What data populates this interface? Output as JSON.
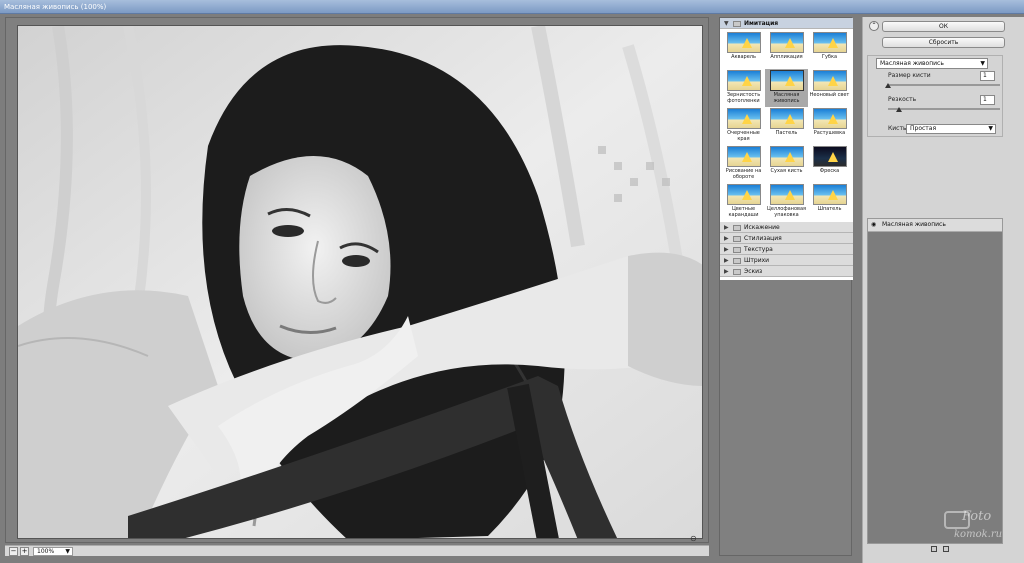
{
  "window": {
    "title": "Масляная живопись (100%)"
  },
  "preview": {
    "zoom": "100%",
    "zoom_minus": "−",
    "zoom_plus": "+"
  },
  "gallery": {
    "open_category": "Имитация",
    "thumbnails": [
      {
        "label": "Акварель"
      },
      {
        "label": "Аппликация"
      },
      {
        "label": "Губка"
      },
      {
        "label": "Зернистость фотопленки"
      },
      {
        "label": "Масляная живопись",
        "selected": true
      },
      {
        "label": "Неоновый свет"
      },
      {
        "label": "Очерченные края"
      },
      {
        "label": "Пастель"
      },
      {
        "label": "Растушевка"
      },
      {
        "label": "Рисование на обороте"
      },
      {
        "label": "Сухая кисть"
      },
      {
        "label": "Фреска",
        "dark": true
      },
      {
        "label": "Цветные карандаши"
      },
      {
        "label": "Целлофановая упаковка"
      },
      {
        "label": "Шпатель"
      }
    ],
    "categories": [
      "Искажение",
      "Стилизация",
      "Текстура",
      "Штрихи",
      "Эскиз"
    ]
  },
  "settings": {
    "ok_label": "ОК",
    "reset_label": "Сбросить",
    "filter_select": "Масляная живопись",
    "brush_size_label": "Размер кисти",
    "brush_size_value": "1",
    "brush_size_level": 0,
    "sharpness_label": "Резкость",
    "sharpness_value": "1",
    "sharpness_level": 0.1,
    "brush_label": "Кисть:",
    "brush_value": "Простая"
  },
  "layers": {
    "active_layer": "Масляная живопись"
  },
  "watermark": {
    "line1": "Foto",
    "line2": "komok.ru"
  }
}
